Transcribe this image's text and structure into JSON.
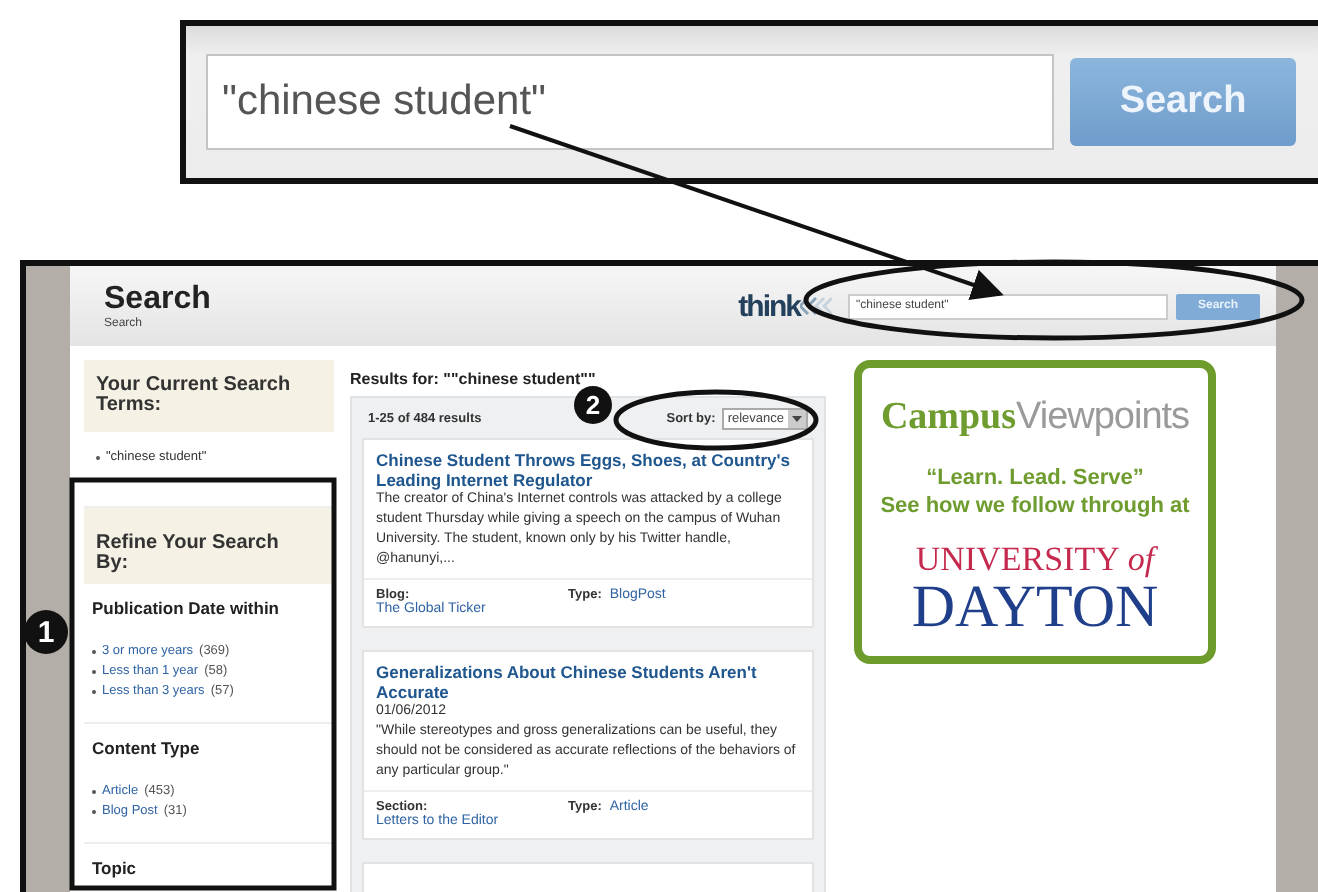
{
  "zoom_inset": {
    "query": "\"chinese student\"",
    "button": "Search"
  },
  "header": {
    "title": "Search",
    "breadcrumb": "Search",
    "logo": "think",
    "query": "\"chinese student\"",
    "button": "Search"
  },
  "sidebar": {
    "current_title": "Your Current Search Terms:",
    "current_terms": [
      "\"chinese student\""
    ],
    "refine_title": "Refine Your Search By:",
    "facets": [
      {
        "title": "Publication Date within",
        "options": [
          {
            "label": "3 or more years",
            "count": "(369)"
          },
          {
            "label": "Less than 1 year",
            "count": "(58)"
          },
          {
            "label": "Less than 3 years",
            "count": "(57)"
          }
        ]
      },
      {
        "title": "Content Type",
        "options": [
          {
            "label": "Article",
            "count": "(453)"
          },
          {
            "label": "Blog Post",
            "count": "(31)"
          }
        ]
      },
      {
        "title": "Topic"
      }
    ]
  },
  "results": {
    "heading": "Results for: \"\"chinese student\"\"",
    "count": "1-25 of 484 results",
    "sort_label": "Sort by:",
    "sort_value": "relevance",
    "items": [
      {
        "title": "Chinese Student Throws Eggs, Shoes, at Country's Leading Internet Regulator",
        "snippet": "The creator of China's Internet controls was attacked by a college student Thursday while giving a speech on the campus of Wuhan University. The student, known only by his Twitter handle, @hanunyi,...",
        "meta": [
          {
            "label": "Blog:",
            "value": "The Global Ticker"
          },
          {
            "label": "Type:",
            "value": "BlogPost"
          }
        ]
      },
      {
        "title": "Generalizations About Chinese Students Aren't Accurate",
        "date": "01/06/2012",
        "snippet": "\"While stereotypes and gross generalizations can be useful, they should not be considered as accurate reflections of the behaviors of any particular group.\"",
        "meta": [
          {
            "label": "Section:",
            "value": "Letters to the Editor"
          },
          {
            "label": "Type:",
            "value": "Article"
          }
        ]
      }
    ]
  },
  "ad": {
    "brand_bold": "Campus",
    "brand_light": "Viewpoints",
    "slogan": "“Learn. Lead. Serve”",
    "line": "See how we follow through at",
    "university": "UNIVERSITY",
    "of": "of",
    "name": "DAYTON"
  },
  "callouts": [
    {
      "number": "1"
    },
    {
      "number": "2"
    }
  ]
}
